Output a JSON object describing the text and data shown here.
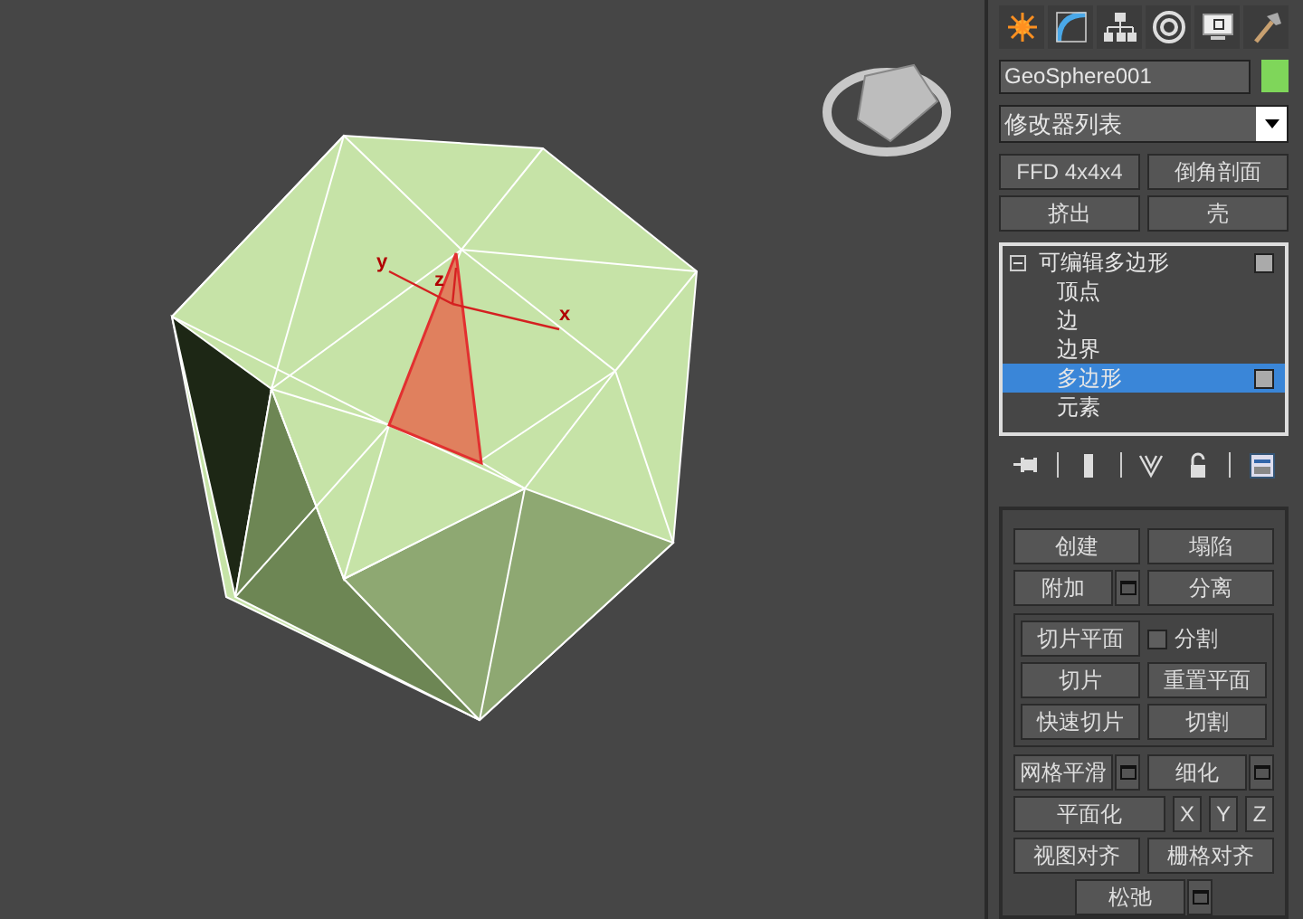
{
  "viewport": {
    "axis_labels": [
      {
        "kind": "y",
        "text": "y"
      },
      {
        "kind": "z",
        "text": "z"
      },
      {
        "kind": "x",
        "text": "x"
      }
    ]
  },
  "command_panel": {
    "object_name": "GeoSphere001",
    "modifier_list": "修改器列表",
    "modifier_buttons": [
      "FFD 4x4x4",
      "倒角剖面",
      "挤出",
      "壳"
    ],
    "stack": {
      "label": "可编辑多边形",
      "expanded": true,
      "children": [
        {
          "label": "顶点",
          "selected": false
        },
        {
          "label": "边",
          "selected": false
        },
        {
          "label": "边界",
          "selected": false
        },
        {
          "label": "多边形",
          "selected": true
        },
        {
          "label": "元素",
          "selected": false
        }
      ]
    },
    "rollout": [
      {
        "kind": "buttons",
        "buttons": [
          {
            "label": "创建",
            "settings": false
          },
          {
            "label": "塌陷",
            "settings": false
          }
        ]
      },
      {
        "kind": "buttons",
        "buttons": [
          {
            "label": "附加",
            "settings": true
          },
          {
            "label": "分离",
            "settings": false
          }
        ]
      },
      {
        "kind": "group",
        "rows": [
          {
            "kind": "checkbox",
            "button": "切片平面",
            "checkbox": {
              "label": "分割",
              "checked": false
            }
          },
          {
            "kind": "buttons",
            "buttons": [
              {
                "label": "切片",
                "settings": false
              },
              {
                "label": "重置平面",
                "settings": false
              }
            ]
          },
          {
            "kind": "buttons",
            "buttons": [
              {
                "label": "快速切片",
                "settings": false
              },
              {
                "label": "切割",
                "settings": false
              }
            ]
          }
        ]
      },
      {
        "kind": "buttons",
        "buttons": [
          {
            "label": "网格平滑",
            "settings": true
          },
          {
            "label": "细化",
            "settings": true
          }
        ]
      },
      {
        "kind": "axes",
        "button": "平面化",
        "axes": [
          "X",
          "Y",
          "Z"
        ]
      },
      {
        "kind": "buttons",
        "buttons": [
          {
            "label": "视图对齐",
            "settings": false
          },
          {
            "label": "栅格对齐",
            "settings": false
          }
        ]
      },
      {
        "kind": "single",
        "buttons": [
          {
            "label": "松弛",
            "settings": true
          }
        ]
      }
    ]
  }
}
